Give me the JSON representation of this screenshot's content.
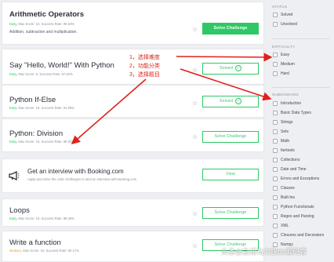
{
  "challenges": [
    {
      "title": "Arithmetic Operators",
      "level": "Easy",
      "meta": ", Max Score: 10, Success Rate: 98.53%",
      "desc": "Addition, subtraction and multiplication.",
      "button": "Solve Challenge"
    },
    {
      "title": "Say \"Hello, World!\" With Python",
      "level": "Easy",
      "meta": ", Max Score: 5, Success Rate: 97.32%",
      "button": "Solved"
    },
    {
      "title": "Python If-Else",
      "level": "Easy",
      "meta": ", Max Score: 10, Success Rate: 91.05%",
      "button": "Solved"
    },
    {
      "title": "Python: Division",
      "level": "Easy",
      "meta": ", Max Score: 10, Success Rate: 98.02%",
      "button": "Solve Challenge"
    },
    {
      "title": "Loops",
      "level": "Easy",
      "meta": ", Max Score: 10, Success Rate: 98.45%",
      "button": "Solve Challenge"
    },
    {
      "title": "Write a function",
      "level": "Medium",
      "meta": ", Max Score: 10, Success Rate: 90.17%",
      "button": "Solve Challenge"
    }
  ],
  "promo": {
    "title": "Get an interview with Booking.com",
    "desc": "Apply and solve the code challenges to land an interview with Booking.com",
    "button": "View"
  },
  "sidebar": {
    "status": {
      "heading": "STATUS",
      "options": [
        "Solved",
        "Unsolved"
      ]
    },
    "difficulty": {
      "heading": "DIFFICULTY",
      "options": [
        "Easy",
        "Medium",
        "Hard"
      ]
    },
    "subdomains": {
      "heading": "SUBDOMAINS",
      "options": [
        "Introduction",
        "Basic Data Types",
        "Strings",
        "Sets",
        "Math",
        "Itertools",
        "Collections",
        "Date and Time",
        "Errors and Exceptions",
        "Classes",
        "Built-Ins",
        "Python Functionals",
        "Regex and Parsing",
        "XML",
        "Closures and Decorators",
        "Numpy"
      ]
    }
  },
  "annotations": [
    "1，选择难度",
    "2，功能分类",
    "3，选择题目"
  ],
  "watermark": "头条@急速马力快de源码客",
  "colors": {
    "accent": "#2ec866",
    "annotation": "#e0211b",
    "background": "#eeeff2"
  }
}
